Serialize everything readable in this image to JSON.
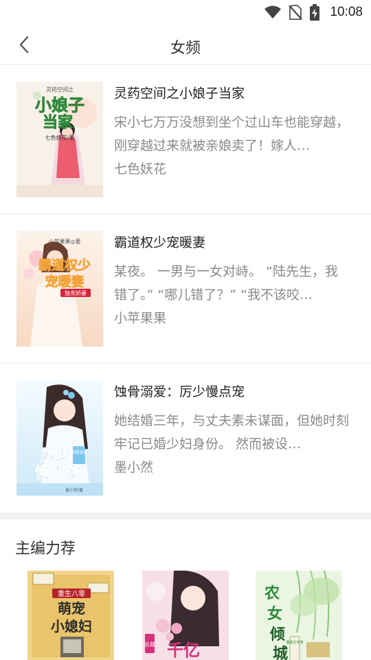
{
  "status_bar": {
    "time": "10:08",
    "icons": [
      "wifi-icon",
      "no-sim-icon",
      "battery-charging-icon"
    ]
  },
  "header": {
    "title": "女频",
    "back_icon": "chevron-left-icon"
  },
  "books": [
    {
      "title": "灵药空间之小娘子当家",
      "description": "宋小七万万没想到坐个过山车也能穿越，刚穿越过来就被亲娘卖了！嫁人…",
      "author": "七色妖花",
      "cover": {
        "top_text": "灵药空间之",
        "big_text": "小娘子当家",
        "author_text": "七色妖花/著",
        "colors": {
          "bg": "#f7f1ea",
          "title": "#e8344a",
          "outline": "#2d8a3a"
        }
      }
    },
    {
      "title": "霸道权少宠暖妻",
      "description": "某夜。 一男与一女对峙。 “陆先生，我错了。” “哪儿错了？” “我不该咬…",
      "author": "小苹果果",
      "cover": {
        "top_text": "小苹果果◎著",
        "big_text": "霸道权少宠暖妻",
        "badge_text": "独宠娇妻",
        "colors": {
          "bg": "#fbe9dd",
          "title": "#d9233a",
          "accent": "#f2a43a"
        }
      }
    },
    {
      "title": "蚀骨溺爱：厉少慢点宠",
      "description": "她结婚三年，与丈夫素未谋面，但她时刻牢记已婚少妇身份。 然而被设…",
      "author": "墨小然",
      "cover": {
        "big_text": "厉少慢点宠",
        "badge_text": "蚀骨溺爱",
        "author_text": "墨小然/著",
        "colors": {
          "bg": "#dff1fb",
          "title": "#1d6fd8",
          "accent": "#7cc7ee"
        }
      }
    }
  ],
  "recommend": {
    "title": "主编力荐",
    "covers": [
      {
        "top_text": "重生八零",
        "big_text": "萌宠小媳妇",
        "colors": {
          "bg": "#f2d58a",
          "title": "#b8242a"
        }
      },
      {
        "badge_text": "总裁",
        "big_text": "千亿",
        "colors": {
          "bg": "#f6dfe8",
          "title": "#d8307a"
        }
      },
      {
        "big_text": "农女倾城",
        "badge_text": "腹黑王爷宠",
        "colors": {
          "bg": "#eaf5e2",
          "title": "#2f8a3b"
        }
      }
    ]
  }
}
